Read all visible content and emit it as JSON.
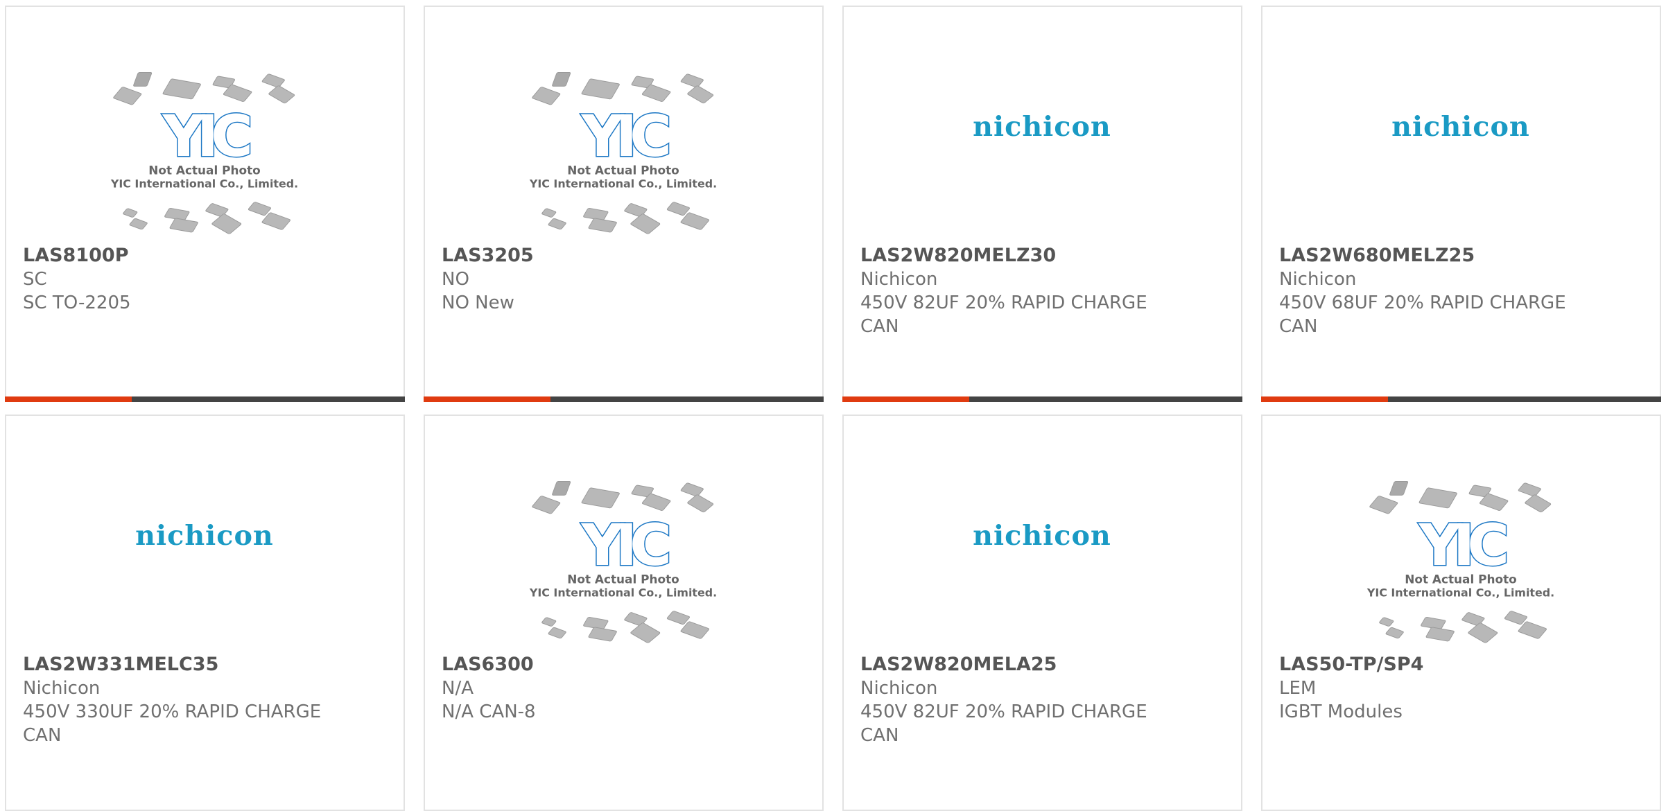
{
  "products": [
    {
      "part": "LAS8100P",
      "mfr": "SC",
      "desc": "SC TO-2205",
      "image": "yic-placeholder"
    },
    {
      "part": "LAS3205",
      "mfr": "NO",
      "desc": "NO New",
      "image": "yic-placeholder"
    },
    {
      "part": "LAS2W820MELZ30",
      "mfr": "Nichicon",
      "desc": "450V 82UF 20% RAPID CHARGE CAN",
      "image": "nichicon-logo"
    },
    {
      "part": "LAS2W680MELZ25",
      "mfr": "Nichicon",
      "desc": "450V 68UF 20% RAPID CHARGE CAN",
      "image": "nichicon-logo"
    },
    {
      "part": "LAS2W331MELC35",
      "mfr": "Nichicon",
      "desc": "450V 330UF 20% RAPID CHARGE CAN",
      "image": "nichicon-logo"
    },
    {
      "part": "LAS6300",
      "mfr": "N/A",
      "desc": "N/A CAN-8",
      "image": "yic-placeholder"
    },
    {
      "part": "LAS2W820MELA25",
      "mfr": "Nichicon",
      "desc": "450V 82UF 20% RAPID CHARGE CAN",
      "image": "nichicon-logo"
    },
    {
      "part": "LAS50-TP/SP4",
      "mfr": "LEM",
      "desc": "IGBT Modules",
      "image": "yic-placeholder"
    }
  ],
  "placeholder": {
    "line1": "Not Actual Photo",
    "line2": "YIC International Co., Limited.",
    "logo_text": "YIC"
  },
  "nichicon": {
    "logo_text": "nichicon"
  },
  "colors": {
    "accent": "#e03b10",
    "bar": "#444444",
    "border": "#e2e2e2",
    "nichicon": "#1a9ac4",
    "yic": "#1a76c4"
  }
}
